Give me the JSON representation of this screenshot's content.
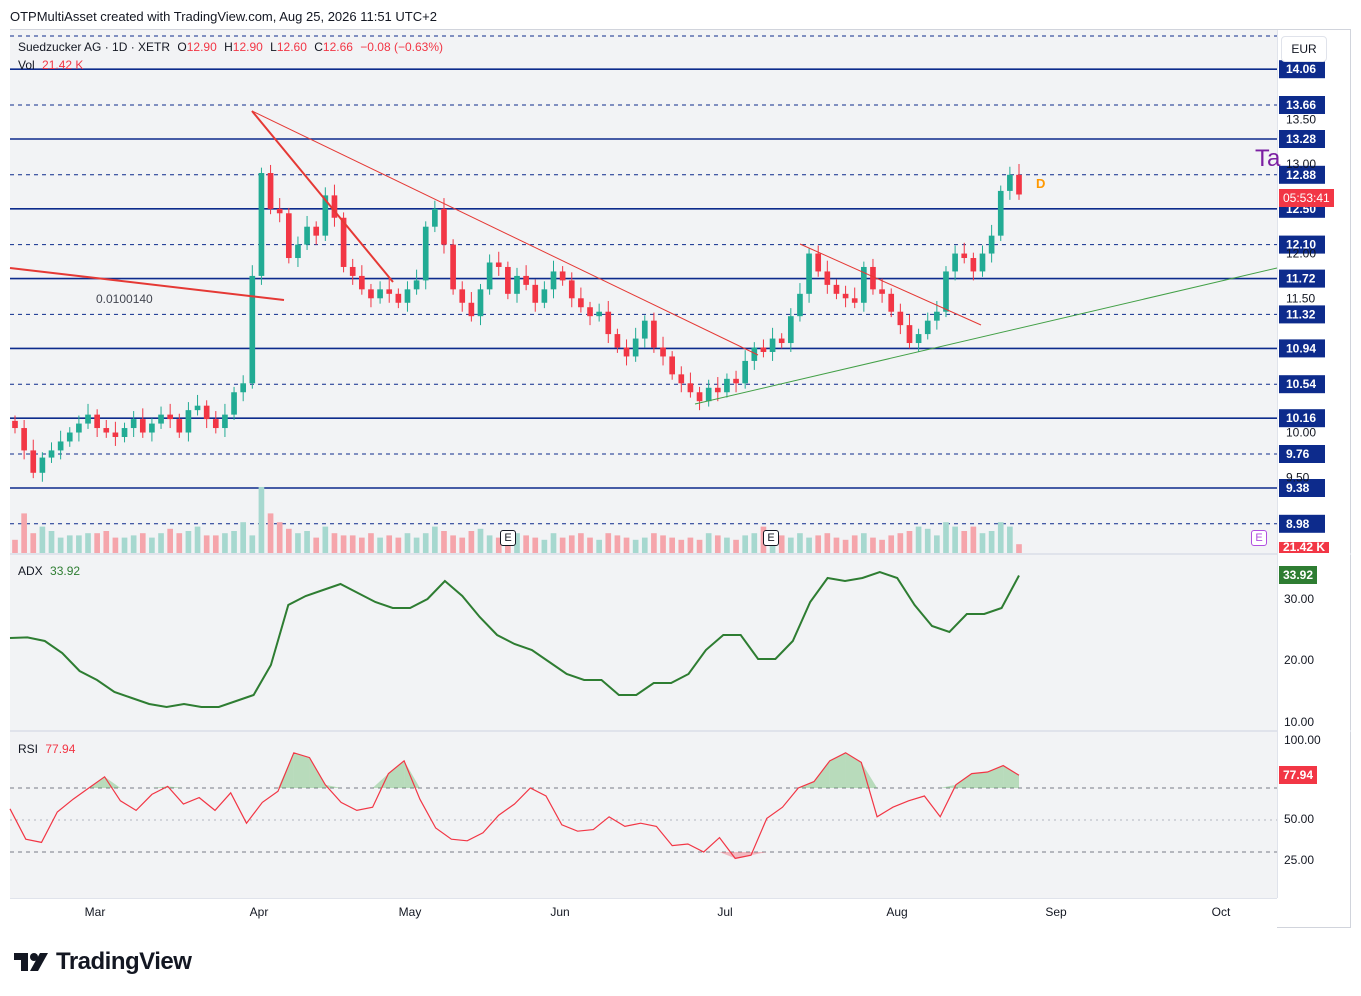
{
  "header": {
    "text": "OTPMultiAsset created with TradingView.com, Aug 25, 2026 11:51 UTC+2"
  },
  "currency": "EUR",
  "legend": {
    "symbol": "Suedzucker AG · 1D · XETR",
    "o_label": "O",
    "o": "12.90",
    "h_label": "H",
    "h": "12.90",
    "l_label": "L",
    "l": "12.60",
    "c_label": "C",
    "c": "12.66",
    "change": "−0.08 (−0.63%)",
    "vol_label": "Vol",
    "vol": "21.42 K"
  },
  "adx": {
    "label": "ADX",
    "value": "33.92"
  },
  "rsi": {
    "label": "RSI",
    "value": "77.94"
  },
  "annotation": "0.0100140",
  "countdown": "05:53:41",
  "vol_tag": "21.42 K",
  "letter_d": "D",
  "letter_e": "E",
  "partial_text": "Ta",
  "colors": {
    "up": "#22ab94",
    "down": "#f23645",
    "level": "#0d2b8c",
    "adx": "#2e7d32",
    "rsi": "#f23645"
  },
  "brand": "TradingView",
  "chart_data": {
    "type": "candlestick",
    "price_range": [
      8.85,
      14.15
    ],
    "price_ticks": [
      "13.50",
      "13.00",
      "12.00",
      "11.50",
      "10.00",
      "9.50"
    ],
    "horizontal_levels": [
      {
        "value": 14.06,
        "label": "14.06",
        "style": "solid"
      },
      {
        "value": 13.66,
        "label": "13.66",
        "style": "dashed"
      },
      {
        "value": 13.28,
        "label": "13.28",
        "style": "solid"
      },
      {
        "value": 12.88,
        "label": "12.88",
        "style": "dashed"
      },
      {
        "value": 12.5,
        "label": "12.50",
        "style": "solid"
      },
      {
        "value": 12.1,
        "label": "12.10",
        "style": "dashed"
      },
      {
        "value": 11.72,
        "label": "11.72",
        "style": "solid"
      },
      {
        "value": 11.32,
        "label": "11.32",
        "style": "dashed"
      },
      {
        "value": 10.94,
        "label": "10.94",
        "style": "solid"
      },
      {
        "value": 10.54,
        "label": "10.54",
        "style": "dashed"
      },
      {
        "value": 10.16,
        "label": "10.16",
        "style": "solid"
      },
      {
        "value": 9.76,
        "label": "9.76",
        "style": "dashed"
      },
      {
        "value": 9.38,
        "label": "9.38",
        "style": "solid"
      },
      {
        "value": 8.98,
        "label": "8.98",
        "style": "dashed"
      }
    ],
    "x_labels": [
      "Mar",
      "Apr",
      "May",
      "Jun",
      "Jul",
      "Aug",
      "Sep",
      "Oct"
    ],
    "closes": [
      10.05,
      9.8,
      9.55,
      9.72,
      9.8,
      9.9,
      10.0,
      10.1,
      10.2,
      10.05,
      10.0,
      9.95,
      10.05,
      10.15,
      10.0,
      10.1,
      10.2,
      10.15,
      10.0,
      10.25,
      10.3,
      10.15,
      10.05,
      10.2,
      10.45,
      10.55,
      11.75,
      12.9,
      12.5,
      12.45,
      11.95,
      12.1,
      12.3,
      12.2,
      12.65,
      12.4,
      11.85,
      11.75,
      11.6,
      11.5,
      11.6,
      11.55,
      11.45,
      11.6,
      11.7,
      12.3,
      12.5,
      12.1,
      11.6,
      11.45,
      11.3,
      11.6,
      11.9,
      11.85,
      11.55,
      11.75,
      11.65,
      11.45,
      11.6,
      11.8,
      11.7,
      11.5,
      11.4,
      11.3,
      11.35,
      11.1,
      10.95,
      10.85,
      11.05,
      11.25,
      10.95,
      10.85,
      10.65,
      10.55,
      10.45,
      10.35,
      10.5,
      10.45,
      10.6,
      10.55,
      10.8,
      10.95,
      10.9,
      11.05,
      11.0,
      11.3,
      11.55,
      12.0,
      11.8,
      11.65,
      11.55,
      11.5,
      11.45,
      11.85,
      11.6,
      11.55,
      11.35,
      11.2,
      11.0,
      11.1,
      11.25,
      11.35,
      11.8,
      12.0,
      11.95,
      11.8,
      12.0,
      12.2,
      12.7,
      12.88,
      12.66
    ],
    "volumes": [
      6,
      18,
      9,
      12,
      10,
      7,
      8,
      8,
      9,
      9,
      10,
      7,
      7,
      8,
      9,
      7,
      9,
      11,
      9,
      10,
      12,
      8,
      8,
      9,
      10,
      14,
      8,
      30,
      18,
      14,
      11,
      9,
      10,
      7,
      12,
      9,
      8,
      8,
      7,
      9,
      7,
      8,
      7,
      9,
      7,
      9,
      12,
      10,
      8,
      7,
      10,
      11,
      8,
      7,
      6,
      9,
      8,
      7,
      6,
      9,
      7,
      8,
      9,
      7,
      6,
      9,
      8,
      7,
      6,
      7,
      9,
      8,
      7,
      6,
      7,
      6,
      9,
      8,
      7,
      6,
      8,
      9,
      12,
      10,
      8,
      7,
      9,
      7,
      8,
      9,
      7,
      6,
      8,
      9,
      7,
      6,
      8,
      9,
      10,
      12,
      11,
      8,
      14,
      12,
      10,
      12,
      9,
      10,
      14,
      12,
      4
    ],
    "adx": [
      23.5,
      23.6,
      23.0,
      21.0,
      18.0,
      16.5,
      14.5,
      13.5,
      12.5,
      12.0,
      12.5,
      12.0,
      12.0,
      13.0,
      14.0,
      19.0,
      29.0,
      30.5,
      31.5,
      32.5,
      31.0,
      29.5,
      28.5,
      28.5,
      30.0,
      33.0,
      30.5,
      27.0,
      24.0,
      22.5,
      21.5,
      19.5,
      17.5,
      16.5,
      16.5,
      14.0,
      14.0,
      16.0,
      16.0,
      17.5,
      21.5,
      24.0,
      24.0,
      20.0,
      20.0,
      23.0,
      29.5,
      33.5,
      33.0,
      33.5,
      34.5,
      33.5,
      29.0,
      25.5,
      24.5,
      27.5,
      27.5,
      28.5,
      33.92
    ],
    "rsi": [
      57,
      38,
      36,
      55,
      63,
      70,
      77,
      62,
      56,
      66,
      71,
      60,
      64,
      56,
      67,
      48,
      61,
      68,
      92,
      89,
      72,
      61,
      56,
      58,
      79,
      87,
      63,
      45,
      38,
      37,
      42,
      53,
      60,
      70,
      65,
      47,
      43,
      44,
      52,
      46,
      48,
      46,
      34,
      35,
      30,
      39,
      26,
      28,
      51,
      58,
      70,
      74,
      87,
      92,
      86,
      52,
      58,
      62,
      65,
      52,
      72,
      79,
      80,
      84,
      77.94
    ]
  }
}
